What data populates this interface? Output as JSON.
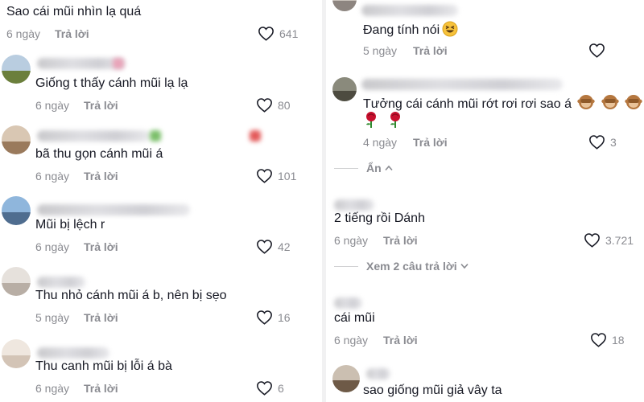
{
  "left_column": {
    "comments": [
      {
        "text": "Sao cái mũi nhìn lạ quá",
        "date": "6 ngày",
        "reply_label": "Trả lời",
        "likes": "641"
      },
      {
        "text": "Giống t thấy cánh mũi lạ lạ",
        "date": "6 ngày",
        "reply_label": "Trả lời",
        "likes": "80"
      },
      {
        "text": "bã thu gọn cánh mũi á",
        "date": "6 ngày",
        "reply_label": "Trả lời",
        "likes": "101"
      },
      {
        "text": "Mũi bị lệch r",
        "date": "6 ngày",
        "reply_label": "Trả lời",
        "likes": "42"
      },
      {
        "text": "Thu nhỏ cánh mũi á b, nên bị sẹo",
        "date": "5 ngày",
        "reply_label": "Trả lời",
        "likes": "16"
      },
      {
        "text": "Thu canh mũi bị lỗi á bà",
        "date": "6 ngày",
        "reply_label": "Trả lời",
        "likes": "6"
      }
    ]
  },
  "right_column": {
    "reply_1": {
      "text": "Đang tính nói",
      "emoji_icon": "grinning-squint-emoji",
      "date": "5 ngày",
      "reply_label": "Trả lời"
    },
    "reply_2": {
      "text": "Tưởng cái cánh mũi rớt rơi rơi sao á",
      "emoji_icons": [
        "see-no-evil-monkey-emoji",
        "see-no-evil-monkey-emoji",
        "see-no-evil-monkey-emoji",
        "rose-emoji",
        "rose-emoji"
      ],
      "date": "4 ngày",
      "reply_label": "Trả lời",
      "likes": "3"
    },
    "hide_replies_label": "Ẩn",
    "comment_3": {
      "text": "2 tiếng rồi Dánh",
      "date": "6 ngày",
      "reply_label": "Trả lời",
      "likes": "3.721"
    },
    "view_replies_label": "Xem 2 câu trả lời",
    "comment_4": {
      "text": "cái mũi",
      "date": "6 ngày",
      "reply_label": "Trả lời",
      "likes": "18"
    },
    "comment_5": {
      "text": "sao giống mũi giả vây ta"
    }
  },
  "colors": {
    "text": "#161823",
    "meta": "#8a8b91",
    "divider": "#f1f1f2",
    "rose": "#c8102e",
    "monkey": "#b5773f"
  }
}
